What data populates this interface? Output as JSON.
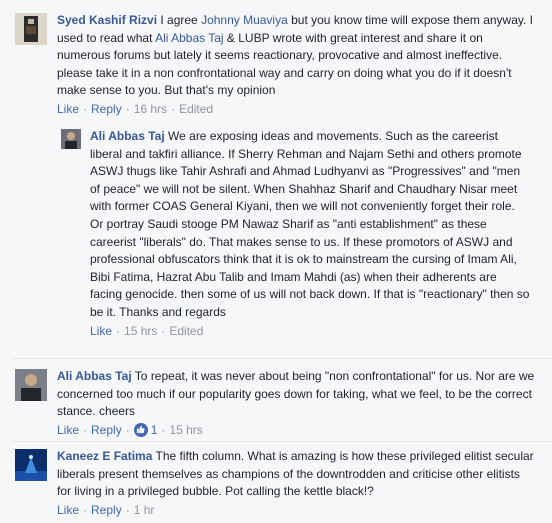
{
  "comments": [
    {
      "author": "Syed Kashif Rizvi",
      "text_parts": [
        " I agree ",
        "Johnny Muaviya",
        " but you know time will expose them anyway. I used to read what ",
        "Ali Abbas Taj",
        " & LUBP wrote with great interest and share it on numerous forums but lately it seems reactionary, provocative and almost ineffective. please take it in a non confrontational way and carry on doing what you do if it doesn't make sense to you. But that's my opinion"
      ],
      "like": "Like",
      "reply": "Reply",
      "time": "16 hrs",
      "edited": "Edited"
    },
    {
      "author": "Ali Abbas Taj",
      "text": " We are exposing ideas and movements. Such as the careerist liberal and takfiri alliance. If Sherry Rehman and Najam Sethi and others promote ASWJ thugs like Tahir Ashrafi and Ahmad Ludhyanvi as \"Progressives\" and \"men of peace\" we will not be silent. When Shahhaz Sharif and Chaudhary Nisar meet with former COAS General Kiyani, then we will not conveniently forget their role. Or portray Saudi stooge PM Nawaz Sharif as \"anti establishment\" as these careerist \"liberals\" do. That makes sense to us. If these promotors of ASWJ and professional obfuscators think that it is ok to mainstream the cursing of Imam Ali, Bibi Fatima, Hazrat Abu Talib and Imam Mahdi (as) when their adherents are facing genocide. then some of us will not back down. If that is \"reactionary\" then so be it. Thanks and regards",
      "like": "Like",
      "time": "15 hrs",
      "edited": "Edited"
    },
    {
      "author": "Ali Abbas Taj",
      "text": " To repeat, it was never about being \"non confrontational\" for us. Nor are we concerned too much if our popularity goes down for taking, what we feel, to be the correct stance. cheers",
      "like": "Like",
      "reply": "Reply",
      "like_count": "1",
      "time": "15 hrs"
    },
    {
      "author": "Kaneez E Fatima",
      "text": " The fifth column. What is amazing is how these privileged elitist secular liberals present themselves as champions of the downtrodden and criticise other elitists for living in a privileged bubble. Pot calling the kettle black!?",
      "like": "Like",
      "reply": "Reply",
      "time": "1 hr"
    }
  ],
  "colors": {
    "link": "#365899",
    "action": "#4267b2",
    "meta": "#90949c",
    "background": "#f6f7f9"
  },
  "icons": [
    "avatar-syed-kashif-rizvi",
    "avatar-ali-abbas-taj",
    "avatar-kaneez-e-fatima",
    "thumbs-up-icon"
  ]
}
